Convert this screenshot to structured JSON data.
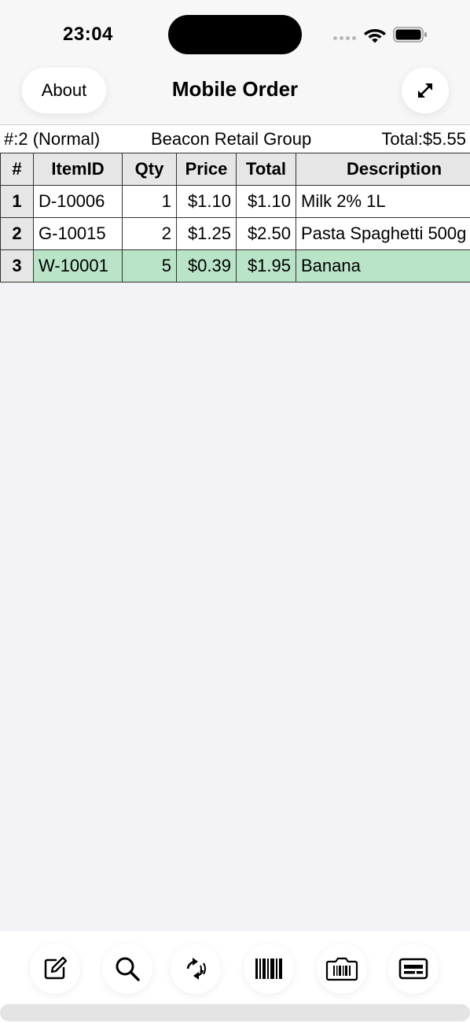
{
  "status_bar": {
    "time": "23:04"
  },
  "nav": {
    "about_label": "About",
    "title": "Mobile Order",
    "expand_icon": "expand-arrows-icon"
  },
  "order": {
    "number": "#:2 (Normal)",
    "customer": "Beacon Retail Group",
    "total": "Total:$5.55"
  },
  "table": {
    "headers": [
      "#",
      "ItemID",
      "Qty",
      "Price",
      "Total",
      "Description"
    ],
    "rows": [
      {
        "num": "1",
        "item_id": "D-10006",
        "qty": "1",
        "price": "$1.10",
        "total": "$1.10",
        "description": "Milk 2% 1L",
        "selected": false
      },
      {
        "num": "2",
        "item_id": "G-10015",
        "qty": "2",
        "price": "$1.25",
        "total": "$2.50",
        "description": "Pasta Spaghetti 500g",
        "selected": false
      },
      {
        "num": "3",
        "item_id": "W-10001",
        "qty": "5",
        "price": "$0.39",
        "total": "$1.95",
        "description": "Banana",
        "selected": true
      }
    ]
  },
  "toolbar": {
    "buttons": [
      {
        "name": "edit-button",
        "icon": "edit-icon"
      },
      {
        "name": "search-button",
        "icon": "search-icon"
      },
      {
        "name": "nfc-sync-button",
        "icon": "nfc-sync-icon"
      },
      {
        "name": "barcode-button",
        "icon": "barcode-icon"
      },
      {
        "name": "camera-barcode-button",
        "icon": "camera-barcode-icon"
      },
      {
        "name": "card-button",
        "icon": "card-icon"
      }
    ]
  },
  "colors": {
    "selected_row": "#b9e4c7",
    "header_bg": "#e6e6e6",
    "background": "#f2f2f7"
  }
}
